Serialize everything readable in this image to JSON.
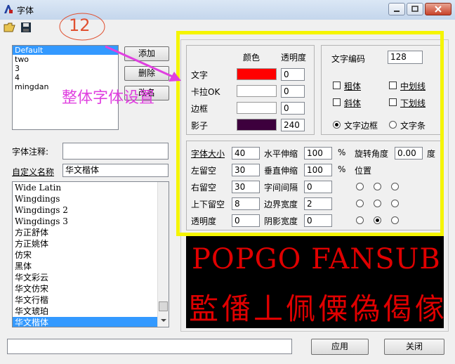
{
  "window": {
    "title": "字体"
  },
  "annotation": {
    "step_number": "12",
    "callout_text": "整体字体设置",
    "highlight_color": "#f5f500",
    "arrow_color": "#e040e0"
  },
  "styles": {
    "items": [
      "Default",
      "two",
      "3",
      "4",
      "mingdan"
    ],
    "selected": "Default",
    "add_label": "添加",
    "delete_label": "删除",
    "modify_label": "改名"
  },
  "comment": {
    "label": "字体注释:",
    "value": ""
  },
  "custom_name": {
    "label": "自定义名称",
    "value": "华文楷体"
  },
  "fonts": {
    "items": [
      "Wide Latin",
      "Wingdings",
      "Wingdings 2",
      "Wingdings 3",
      "方正舒体",
      "方正姚体",
      "仿宋",
      "黑体",
      "华文彩云",
      "华文仿宋",
      "华文行楷",
      "华文琥珀",
      "华文楷体"
    ],
    "selected": "华文楷体"
  },
  "color_panel": {
    "header_color": "颜色",
    "header_alpha": "透明度",
    "rows": [
      {
        "label": "文字",
        "color": "#ff0000",
        "alpha": "0"
      },
      {
        "label": "卡拉OK",
        "color": "#ffffff",
        "alpha": "0"
      },
      {
        "label": "边框",
        "color": "#ffffff",
        "alpha": "0"
      },
      {
        "label": "影子",
        "color": "#3d003d",
        "alpha": "240"
      }
    ]
  },
  "encoding_panel": {
    "label": "文字编码",
    "value": "128",
    "bold": "粗体",
    "italic": "斜体",
    "underline": "中划线",
    "strike": "下划线",
    "radio_border": "文字边框",
    "radio_bar": "文字条",
    "selected_radio": "文字边框"
  },
  "size_panel": {
    "font_size_label": "字体大小",
    "font_size": "40",
    "left_margin_label": "左留空",
    "left_margin": "30",
    "right_margin_label": "右留空",
    "right_margin": "30",
    "vertical_margin_label": "上下留空",
    "vertical_margin": "8",
    "transparency_label": "透明度",
    "transparency": "0",
    "h_scale_label": "水平伸缩",
    "h_scale": "100",
    "v_scale_label": "垂直伸缩",
    "v_scale": "100",
    "spacing_label": "字间间隔",
    "spacing": "0",
    "border_width_label": "边界宽度",
    "border_width": "2",
    "shadow_width_label": "阴影宽度",
    "shadow_width": "0",
    "percent": "%",
    "rotation_label": "旋转角度",
    "rotation": "0.00",
    "degree": "度",
    "position_label": "位置",
    "position_selected": "bottom-center"
  },
  "preview": {
    "line1": "POPGO FANSUB",
    "line2": "監僠丄佩僳偽偈傢"
  },
  "footer": {
    "apply_label": "应用",
    "close_label": "关闭",
    "status": ""
  }
}
